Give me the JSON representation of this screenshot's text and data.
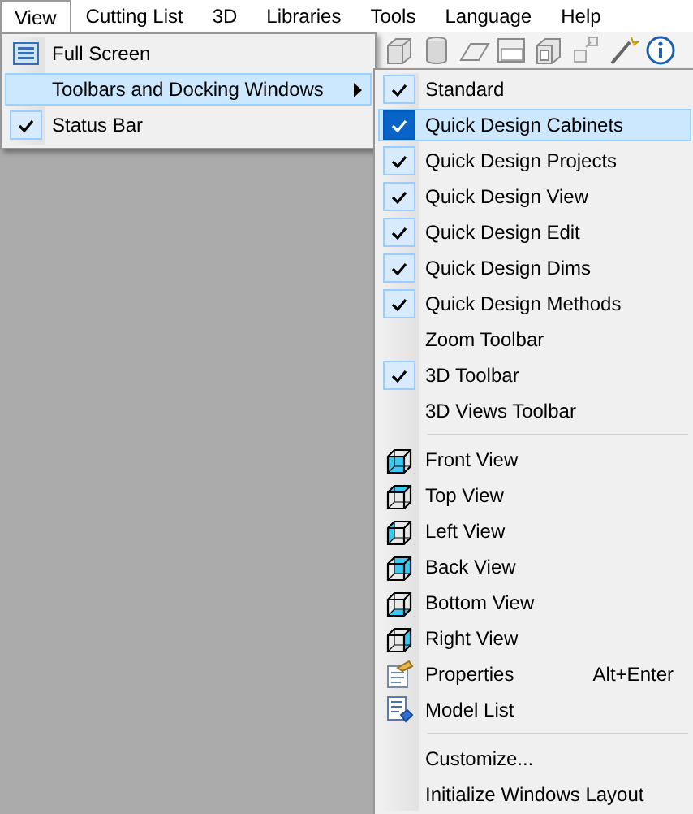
{
  "menu_bar": [
    {
      "label": "View",
      "selected": true
    },
    {
      "label": "Cutting List",
      "selected": false
    },
    {
      "label": "3D",
      "selected": false
    },
    {
      "label": "Libraries",
      "selected": false
    },
    {
      "label": "Tools",
      "selected": false
    },
    {
      "label": "Language",
      "selected": false
    },
    {
      "label": "Help",
      "selected": false
    }
  ],
  "view_menu": [
    {
      "label": "Full Screen",
      "kind": "screen",
      "checked": false,
      "selected": false
    },
    {
      "label": "Toolbars and Docking Windows",
      "kind": "submenu",
      "checked": false,
      "selected": true
    },
    {
      "label": "Status Bar",
      "kind": "plain",
      "checked": true,
      "selected": false
    }
  ],
  "submenu": [
    [
      {
        "label": "Standard",
        "kind": "plain",
        "checked": true,
        "selected": false
      },
      {
        "label": "Quick Design Cabinets",
        "kind": "plain",
        "checked": true,
        "selected": true
      },
      {
        "label": "Quick Design Projects",
        "kind": "plain",
        "checked": true,
        "selected": false
      },
      {
        "label": "Quick Design View",
        "kind": "plain",
        "checked": true,
        "selected": false
      },
      {
        "label": "Quick Design Edit",
        "kind": "plain",
        "checked": true,
        "selected": false
      },
      {
        "label": "Quick Design Dims",
        "kind": "plain",
        "checked": true,
        "selected": false
      },
      {
        "label": "Quick Design Methods",
        "kind": "plain",
        "checked": true,
        "selected": false
      },
      {
        "label": "Zoom Toolbar",
        "kind": "plain",
        "checked": false,
        "selected": false
      },
      {
        "label": "3D Toolbar",
        "kind": "plain",
        "checked": true,
        "selected": false
      },
      {
        "label": "3D Views Toolbar",
        "kind": "plain",
        "checked": false,
        "selected": false
      }
    ],
    [
      {
        "label": "Front View",
        "kind": "cube",
        "checked": false,
        "selected": false
      },
      {
        "label": "Top View",
        "kind": "cube",
        "checked": false,
        "selected": false
      },
      {
        "label": "Left View",
        "kind": "cube",
        "checked": false,
        "selected": false
      },
      {
        "label": "Back View",
        "kind": "cube",
        "checked": false,
        "selected": false
      },
      {
        "label": "Bottom View",
        "kind": "cube",
        "checked": false,
        "selected": false
      },
      {
        "label": "Right View",
        "kind": "cube",
        "checked": false,
        "selected": false
      },
      {
        "label": "Properties",
        "kind": "properties",
        "checked": false,
        "selected": false,
        "shortcut": "Alt+Enter"
      },
      {
        "label": "Model List",
        "kind": "list",
        "checked": false,
        "selected": false
      }
    ],
    [
      {
        "label": "Customize...",
        "kind": "plain",
        "checked": false,
        "selected": false
      },
      {
        "label": "Initialize Windows Layout",
        "kind": "plain",
        "checked": false,
        "selected": false
      }
    ]
  ]
}
